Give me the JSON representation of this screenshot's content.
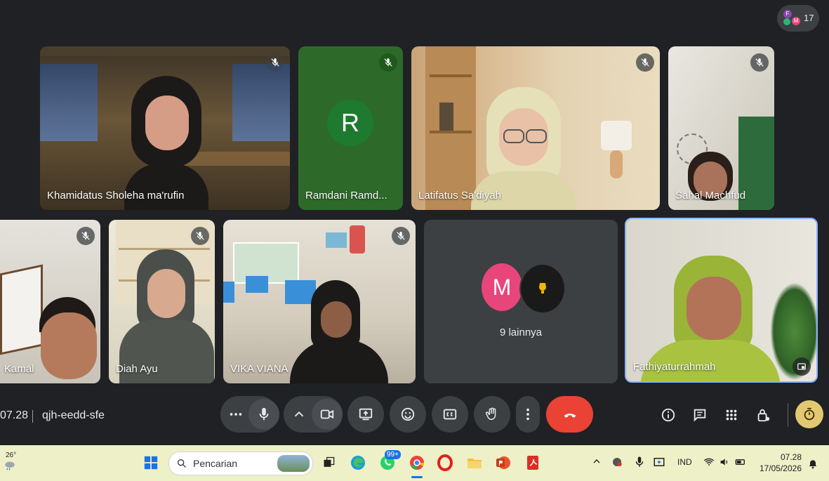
{
  "meeting": {
    "participant_count": "17",
    "avatar_initials": [
      "F",
      "M"
    ],
    "time": "07.28",
    "code": "qjh-eedd-sfe"
  },
  "tiles": [
    {
      "name": "Khamidatus Sholeha ma'rufin",
      "muted": true
    },
    {
      "name": "Ramdani Ramd...",
      "initial": "R",
      "muted": true
    },
    {
      "name": "Latifatus Sa'diyah",
      "muted": true
    },
    {
      "name": "Sahal Machfud",
      "muted": true
    },
    {
      "name": "Kamal",
      "muted": true
    },
    {
      "name": "Diah Ayu",
      "muted": true
    },
    {
      "name": "VIKA VIANA",
      "muted": true
    },
    {
      "name": "9 lainnya",
      "initial": "M"
    },
    {
      "name": "Fathiyaturrahmah"
    }
  ],
  "controls": [
    "more-options",
    "microphone",
    "camera-options",
    "camera",
    "present",
    "reactions",
    "captions",
    "raise-hand",
    "more",
    "leave-call"
  ],
  "right_controls": [
    "info",
    "chat",
    "activities",
    "host-controls",
    "timer"
  ],
  "taskbar": {
    "weather": "26°",
    "search_placeholder": "Pencarian",
    "whatsapp_badge": "99+",
    "language": "IND",
    "clock_time": "07.28",
    "clock_date": "17/05/2026"
  },
  "colors": {
    "leave": "#ea4335",
    "selected_border": "#8ab4f8",
    "green_tile": "#2d6a2a",
    "avatar_green": "#1e7a2f",
    "avatar_pink": "#e8457a"
  }
}
